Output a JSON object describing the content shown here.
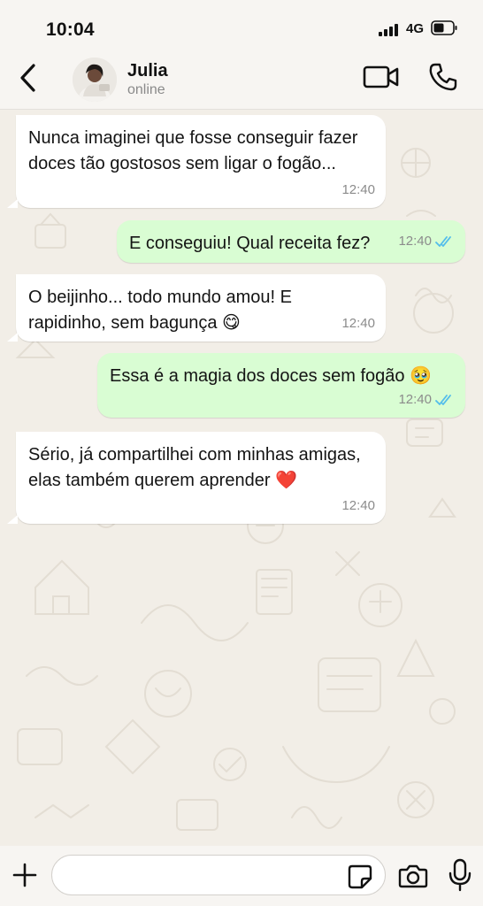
{
  "status_bar": {
    "time": "10:04",
    "network": "4G"
  },
  "header": {
    "name": "Julia",
    "status": "online"
  },
  "messages": [
    {
      "direction": "incoming",
      "text": "Nunca imaginei que fosse conseguir fazer doces tão gostosos sem ligar o fogão...",
      "time": "12:40"
    },
    {
      "direction": "outgoing",
      "text": "E conseguiu! Qual receita fez?",
      "time": "12:40",
      "read": true
    },
    {
      "direction": "incoming",
      "text": "O beijinho... todo mundo amou! E rapidinho, sem bagunça 😋",
      "time": "12:40"
    },
    {
      "direction": "outgoing",
      "text": "Essa é a magia dos doces sem fogão 🥹",
      "time": "12:40",
      "read": true
    },
    {
      "direction": "incoming",
      "text": "Sério, já compartilhei com minhas amigas, elas também querem aprender ❤️",
      "time": "12:40"
    }
  ],
  "input": {
    "placeholder": ""
  },
  "colors": {
    "outgoing_bubble": "#d9fdd3",
    "incoming_bubble": "#ffffff",
    "read_ticks": "#53bdeb",
    "chat_bg": "#f2eee7"
  },
  "icons": [
    "back-icon",
    "video-call-icon",
    "phone-icon",
    "plus-icon",
    "sticker-icon",
    "camera-icon",
    "mic-icon"
  ]
}
